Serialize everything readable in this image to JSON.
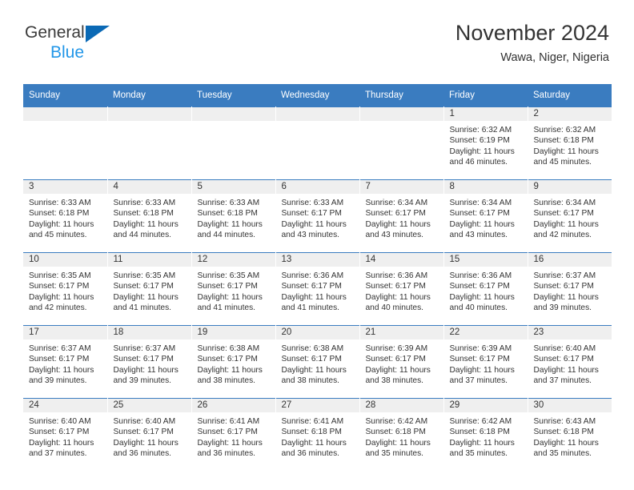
{
  "brand": {
    "line1": "General",
    "line2": "Blue",
    "color_dark": "#3a3a3a",
    "color_blue": "#2196e8",
    "triangle_color": "#0a69b5"
  },
  "header": {
    "title": "November 2024",
    "subtitle": "Wawa, Niger, Nigeria"
  },
  "theme": {
    "header_row_bg": "#3a7cc0",
    "daynum_band_bg": "#efefef",
    "text_color": "#333333"
  },
  "weekday_headers": [
    "Sunday",
    "Monday",
    "Tuesday",
    "Wednesday",
    "Thursday",
    "Friday",
    "Saturday"
  ],
  "weeks": [
    [
      {
        "day": "",
        "empty": true
      },
      {
        "day": "",
        "empty": true
      },
      {
        "day": "",
        "empty": true
      },
      {
        "day": "",
        "empty": true
      },
      {
        "day": "",
        "empty": true
      },
      {
        "day": "1",
        "sunrise": "Sunrise: 6:32 AM",
        "sunset": "Sunset: 6:19 PM",
        "daylight1": "Daylight: 11 hours",
        "daylight2": "and 46 minutes."
      },
      {
        "day": "2",
        "sunrise": "Sunrise: 6:32 AM",
        "sunset": "Sunset: 6:18 PM",
        "daylight1": "Daylight: 11 hours",
        "daylight2": "and 45 minutes."
      }
    ],
    [
      {
        "day": "3",
        "sunrise": "Sunrise: 6:33 AM",
        "sunset": "Sunset: 6:18 PM",
        "daylight1": "Daylight: 11 hours",
        "daylight2": "and 45 minutes."
      },
      {
        "day": "4",
        "sunrise": "Sunrise: 6:33 AM",
        "sunset": "Sunset: 6:18 PM",
        "daylight1": "Daylight: 11 hours",
        "daylight2": "and 44 minutes."
      },
      {
        "day": "5",
        "sunrise": "Sunrise: 6:33 AM",
        "sunset": "Sunset: 6:18 PM",
        "daylight1": "Daylight: 11 hours",
        "daylight2": "and 44 minutes."
      },
      {
        "day": "6",
        "sunrise": "Sunrise: 6:33 AM",
        "sunset": "Sunset: 6:17 PM",
        "daylight1": "Daylight: 11 hours",
        "daylight2": "and 43 minutes."
      },
      {
        "day": "7",
        "sunrise": "Sunrise: 6:34 AM",
        "sunset": "Sunset: 6:17 PM",
        "daylight1": "Daylight: 11 hours",
        "daylight2": "and 43 minutes."
      },
      {
        "day": "8",
        "sunrise": "Sunrise: 6:34 AM",
        "sunset": "Sunset: 6:17 PM",
        "daylight1": "Daylight: 11 hours",
        "daylight2": "and 43 minutes."
      },
      {
        "day": "9",
        "sunrise": "Sunrise: 6:34 AM",
        "sunset": "Sunset: 6:17 PM",
        "daylight1": "Daylight: 11 hours",
        "daylight2": "and 42 minutes."
      }
    ],
    [
      {
        "day": "10",
        "sunrise": "Sunrise: 6:35 AM",
        "sunset": "Sunset: 6:17 PM",
        "daylight1": "Daylight: 11 hours",
        "daylight2": "and 42 minutes."
      },
      {
        "day": "11",
        "sunrise": "Sunrise: 6:35 AM",
        "sunset": "Sunset: 6:17 PM",
        "daylight1": "Daylight: 11 hours",
        "daylight2": "and 41 minutes."
      },
      {
        "day": "12",
        "sunrise": "Sunrise: 6:35 AM",
        "sunset": "Sunset: 6:17 PM",
        "daylight1": "Daylight: 11 hours",
        "daylight2": "and 41 minutes."
      },
      {
        "day": "13",
        "sunrise": "Sunrise: 6:36 AM",
        "sunset": "Sunset: 6:17 PM",
        "daylight1": "Daylight: 11 hours",
        "daylight2": "and 41 minutes."
      },
      {
        "day": "14",
        "sunrise": "Sunrise: 6:36 AM",
        "sunset": "Sunset: 6:17 PM",
        "daylight1": "Daylight: 11 hours",
        "daylight2": "and 40 minutes."
      },
      {
        "day": "15",
        "sunrise": "Sunrise: 6:36 AM",
        "sunset": "Sunset: 6:17 PM",
        "daylight1": "Daylight: 11 hours",
        "daylight2": "and 40 minutes."
      },
      {
        "day": "16",
        "sunrise": "Sunrise: 6:37 AM",
        "sunset": "Sunset: 6:17 PM",
        "daylight1": "Daylight: 11 hours",
        "daylight2": "and 39 minutes."
      }
    ],
    [
      {
        "day": "17",
        "sunrise": "Sunrise: 6:37 AM",
        "sunset": "Sunset: 6:17 PM",
        "daylight1": "Daylight: 11 hours",
        "daylight2": "and 39 minutes."
      },
      {
        "day": "18",
        "sunrise": "Sunrise: 6:37 AM",
        "sunset": "Sunset: 6:17 PM",
        "daylight1": "Daylight: 11 hours",
        "daylight2": "and 39 minutes."
      },
      {
        "day": "19",
        "sunrise": "Sunrise: 6:38 AM",
        "sunset": "Sunset: 6:17 PM",
        "daylight1": "Daylight: 11 hours",
        "daylight2": "and 38 minutes."
      },
      {
        "day": "20",
        "sunrise": "Sunrise: 6:38 AM",
        "sunset": "Sunset: 6:17 PM",
        "daylight1": "Daylight: 11 hours",
        "daylight2": "and 38 minutes."
      },
      {
        "day": "21",
        "sunrise": "Sunrise: 6:39 AM",
        "sunset": "Sunset: 6:17 PM",
        "daylight1": "Daylight: 11 hours",
        "daylight2": "and 38 minutes."
      },
      {
        "day": "22",
        "sunrise": "Sunrise: 6:39 AM",
        "sunset": "Sunset: 6:17 PM",
        "daylight1": "Daylight: 11 hours",
        "daylight2": "and 37 minutes."
      },
      {
        "day": "23",
        "sunrise": "Sunrise: 6:40 AM",
        "sunset": "Sunset: 6:17 PM",
        "daylight1": "Daylight: 11 hours",
        "daylight2": "and 37 minutes."
      }
    ],
    [
      {
        "day": "24",
        "sunrise": "Sunrise: 6:40 AM",
        "sunset": "Sunset: 6:17 PM",
        "daylight1": "Daylight: 11 hours",
        "daylight2": "and 37 minutes."
      },
      {
        "day": "25",
        "sunrise": "Sunrise: 6:40 AM",
        "sunset": "Sunset: 6:17 PM",
        "daylight1": "Daylight: 11 hours",
        "daylight2": "and 36 minutes."
      },
      {
        "day": "26",
        "sunrise": "Sunrise: 6:41 AM",
        "sunset": "Sunset: 6:17 PM",
        "daylight1": "Daylight: 11 hours",
        "daylight2": "and 36 minutes."
      },
      {
        "day": "27",
        "sunrise": "Sunrise: 6:41 AM",
        "sunset": "Sunset: 6:18 PM",
        "daylight1": "Daylight: 11 hours",
        "daylight2": "and 36 minutes."
      },
      {
        "day": "28",
        "sunrise": "Sunrise: 6:42 AM",
        "sunset": "Sunset: 6:18 PM",
        "daylight1": "Daylight: 11 hours",
        "daylight2": "and 35 minutes."
      },
      {
        "day": "29",
        "sunrise": "Sunrise: 6:42 AM",
        "sunset": "Sunset: 6:18 PM",
        "daylight1": "Daylight: 11 hours",
        "daylight2": "and 35 minutes."
      },
      {
        "day": "30",
        "sunrise": "Sunrise: 6:43 AM",
        "sunset": "Sunset: 6:18 PM",
        "daylight1": "Daylight: 11 hours",
        "daylight2": "and 35 minutes."
      }
    ]
  ]
}
